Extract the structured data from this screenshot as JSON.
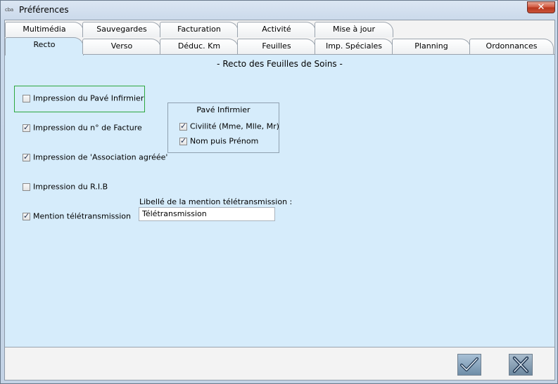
{
  "window": {
    "title": "Préférences",
    "icon": "cba",
    "close_label": "✕"
  },
  "tabs": {
    "back_row": [
      "Multimédia",
      "Sauvegardes",
      "Facturation",
      "Activité",
      "Mise à jour"
    ],
    "front_row": [
      "Recto",
      "Verso",
      "Déduc. Km",
      "Feuilles",
      "Imp. Spéciales",
      "Planning",
      "Ordonnances"
    ],
    "active": "Recto"
  },
  "panel": {
    "title": "- Recto des Feuilles de Soins -",
    "options": [
      {
        "label": "Impression du Pavé Infirmier",
        "checked": false
      },
      {
        "label": "Impression du n° de Facture",
        "checked": true
      },
      {
        "label": "Impression de 'Association agréée'",
        "checked": true
      },
      {
        "label": "Impression du R.I.B",
        "checked": false
      },
      {
        "label": "Mention télétransmission",
        "checked": true
      }
    ],
    "pave_group": {
      "title": "Pavé Infirmier",
      "options": [
        {
          "label": "Civilité (Mme, Mlle, Mr)",
          "checked": true
        },
        {
          "label": "Nom puis Prénom",
          "checked": true
        }
      ]
    },
    "mention_field": {
      "label": "Libellé de la mention télétransmission :",
      "value": "Télétransmission"
    }
  },
  "colors": {
    "panel_bg": "#d6ecfb",
    "highlight_border": "#2da83f",
    "close_red": "#c9533a"
  },
  "icons": {
    "ok": "checkmark-icon",
    "cancel": "cross-icon"
  }
}
